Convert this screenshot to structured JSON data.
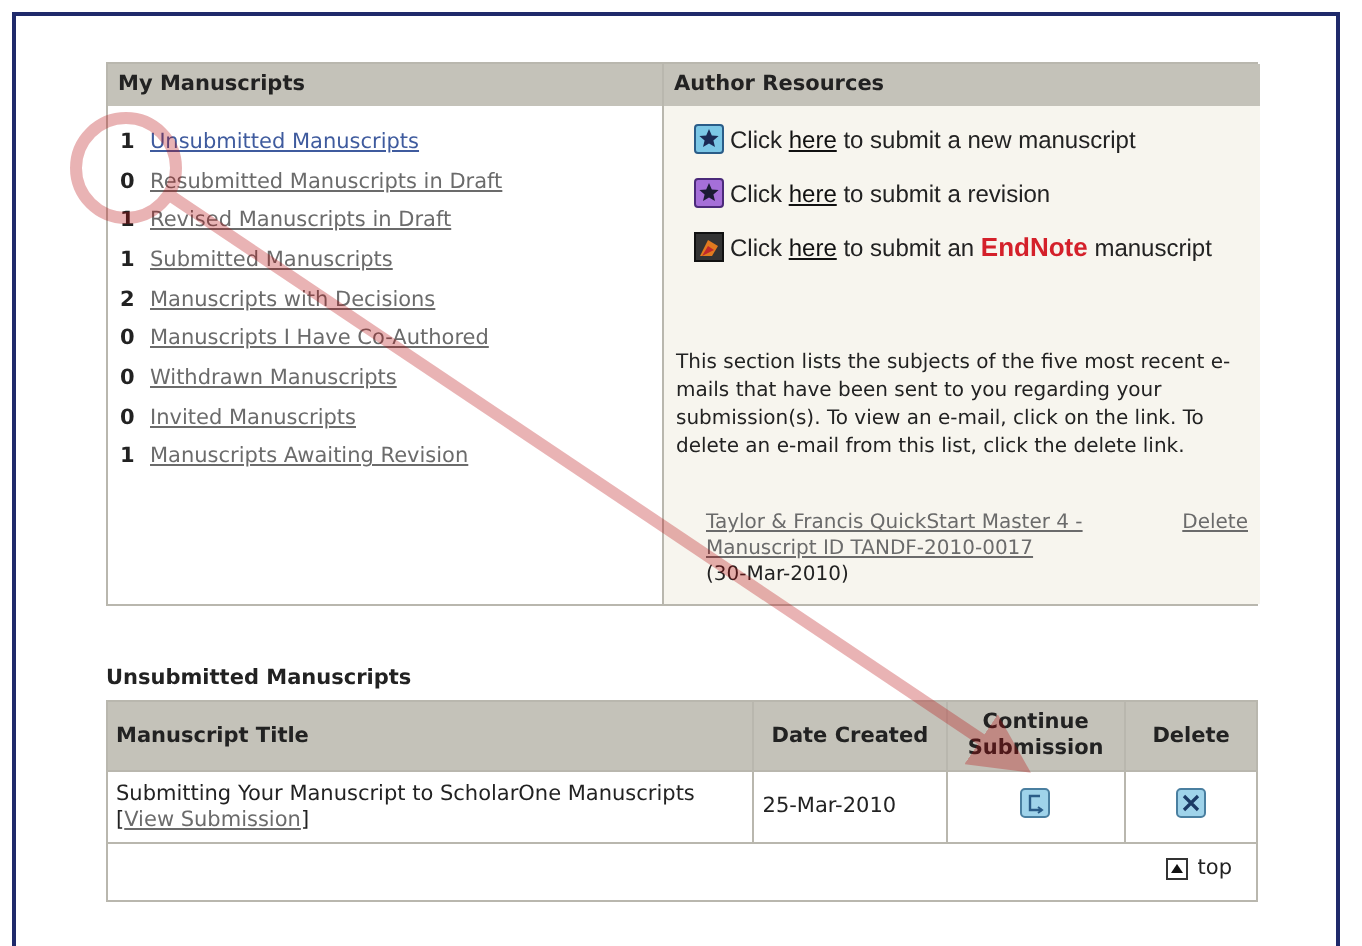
{
  "my_manuscripts": {
    "title": "My Manuscripts",
    "items": [
      {
        "count": "1",
        "label": "Unsubmitted Manuscripts",
        "highlighted": true
      },
      {
        "count": "0",
        "label": "Resubmitted Manuscripts in Draft",
        "highlighted": false
      },
      {
        "count": "1",
        "label": "Revised Manuscripts in Draft",
        "highlighted": false
      },
      {
        "count": "1",
        "label": "Submitted Manuscripts",
        "highlighted": false
      },
      {
        "count": "2",
        "label": "Manuscripts with Decisions",
        "highlighted": false
      },
      {
        "count": "0",
        "label": "Manuscripts I Have Co-Authored",
        "highlighted": false
      },
      {
        "count": "0",
        "label": "Withdrawn Manuscripts",
        "highlighted": false
      },
      {
        "count": "0",
        "label": "Invited Manuscripts",
        "highlighted": false
      },
      {
        "count": "1",
        "label": "Manuscripts Awaiting Revision",
        "highlighted": false
      }
    ]
  },
  "author_resources": {
    "title": "Author Resources",
    "links": [
      {
        "kind": "new",
        "before": "Click ",
        "link": "here",
        "after": " to submit a new manuscript"
      },
      {
        "kind": "revision",
        "before": "Click ",
        "link": "here",
        "after": " to submit a revision"
      },
      {
        "kind": "endnote",
        "before": "Click ",
        "link": "here",
        "after": " to submit an ",
        "logo": "EndNote",
        "tail": " manuscript"
      }
    ],
    "email_note": "This section lists the subjects of the five most recent e-mails that have been sent to you regarding your submission(s). To view an e-mail, click on the link. To delete an e-mail from this list, click the delete link.",
    "emails": [
      {
        "subject": "Taylor & Francis QuickStart Master 4 - Manuscript ID TANDF-2010-0017",
        "date": "(30-Mar-2010)",
        "action": "Delete"
      }
    ]
  },
  "unsubmitted": {
    "title": "Unsubmitted Manuscripts",
    "columns": [
      "Manuscript Title",
      "Date Created",
      "Continue Submission",
      "Delete"
    ],
    "rows": [
      {
        "title_before": "Submitting Your Manuscript to ScholarOne Manuscripts [",
        "link": "View Submission",
        "title_after": "]",
        "date": "25-Mar-2010"
      }
    ],
    "top_link": "top"
  }
}
